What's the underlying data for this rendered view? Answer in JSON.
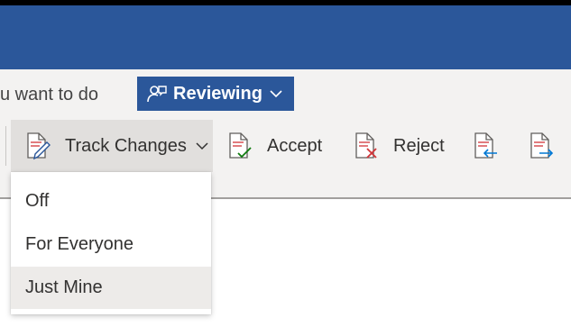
{
  "tell_me": {
    "text": "u want to do"
  },
  "mode_button": {
    "label": "Reviewing",
    "icon": "reviewing-person-icon"
  },
  "ribbon": {
    "track_changes_label": "Track Changes",
    "accept_label": "Accept",
    "reject_label": "Reject",
    "previous_icon": "previous-change-icon",
    "next_icon": "next-change-icon"
  },
  "track_changes_menu": {
    "items": [
      "Off",
      "For Everyone",
      "Just Mine"
    ],
    "highlighted": "Just Mine"
  },
  "colors": {
    "brand_blue": "#2b579a",
    "accept_green": "#107c10",
    "reject_red": "#d13438",
    "nav_blue": "#0078d4",
    "ribbon_bg": "#f3f2f1"
  }
}
